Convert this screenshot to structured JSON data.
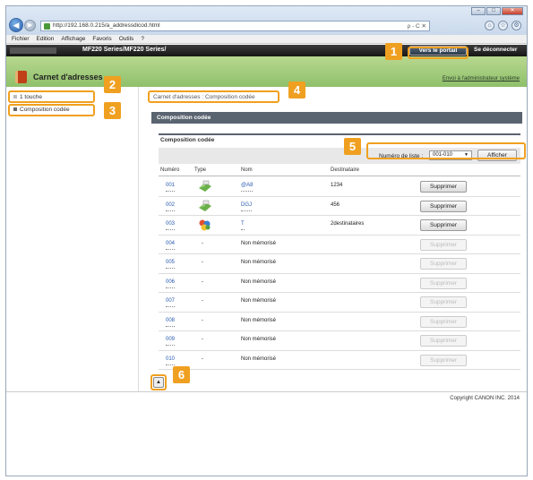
{
  "browser": {
    "url": "http://192.168.0.215/a_addressdicod.html",
    "addr_tools": "ρ - C ✕",
    "window_buttons": [
      "–",
      "□",
      "✕"
    ],
    "menu": [
      "Fichier",
      "Edition",
      "Affichage",
      "Favoris",
      "Outils",
      "?"
    ]
  },
  "header": {
    "model": "MF220 Series/MF220 Series/",
    "portal_button": "Vers le portail",
    "logout": "Se déconnecter",
    "title": "Carnet d'adresses",
    "mail_admin": "Envoi à l'administrateur système"
  },
  "sidebar": {
    "items": [
      {
        "label": "1 touche",
        "selected": false
      },
      {
        "label": "Composition codée",
        "selected": true
      }
    ]
  },
  "main": {
    "breadcrumb": "Carnet d'adresses : Composition codée",
    "section_title": "Composition codée",
    "panel_title": "Composition codée",
    "list_label": "Numéro de liste :",
    "list_value": "001-010",
    "show_button": "Afficher",
    "columns": [
      "Numéro",
      "Type",
      "Nom",
      "Destinataire"
    ],
    "rows": [
      {
        "num": "001",
        "type": "email",
        "name": "@A8",
        "dest": "1234",
        "action": "Supprimer",
        "enabled": true
      },
      {
        "num": "002",
        "type": "email",
        "name": "DGJ",
        "dest": "456",
        "action": "Supprimer",
        "enabled": true
      },
      {
        "num": "003",
        "type": "group",
        "name": "T",
        "dest": "2destinataires",
        "action": "Supprimer",
        "enabled": true
      },
      {
        "num": "004",
        "type": "-",
        "name": "Non mémorisé",
        "dest": "",
        "action": "Supprimer",
        "enabled": false
      },
      {
        "num": "005",
        "type": "-",
        "name": "Non mémorisé",
        "dest": "",
        "action": "Supprimer",
        "enabled": false
      },
      {
        "num": "006",
        "type": "-",
        "name": "Non mémorisé",
        "dest": "",
        "action": "Supprimer",
        "enabled": false
      },
      {
        "num": "007",
        "type": "-",
        "name": "Non mémorisé",
        "dest": "",
        "action": "Supprimer",
        "enabled": false
      },
      {
        "num": "008",
        "type": "-",
        "name": "Non mémorisé",
        "dest": "",
        "action": "Supprimer",
        "enabled": false
      },
      {
        "num": "009",
        "type": "-",
        "name": "Non mémorisé",
        "dest": "",
        "action": "Supprimer",
        "enabled": false
      },
      {
        "num": "010",
        "type": "-",
        "name": "Non mémorisé",
        "dest": "",
        "action": "Supprimer",
        "enabled": false
      }
    ]
  },
  "footer": {
    "copyright": "Copyright CANON INC. 2014"
  },
  "callouts": [
    "1",
    "2",
    "3",
    "4",
    "5",
    "6"
  ],
  "colors": {
    "callout": "#f0a020",
    "header_dark": "#161616",
    "header_green": "#8fc06a",
    "section_bar": "#5a6470",
    "link": "#2a5ab0"
  }
}
